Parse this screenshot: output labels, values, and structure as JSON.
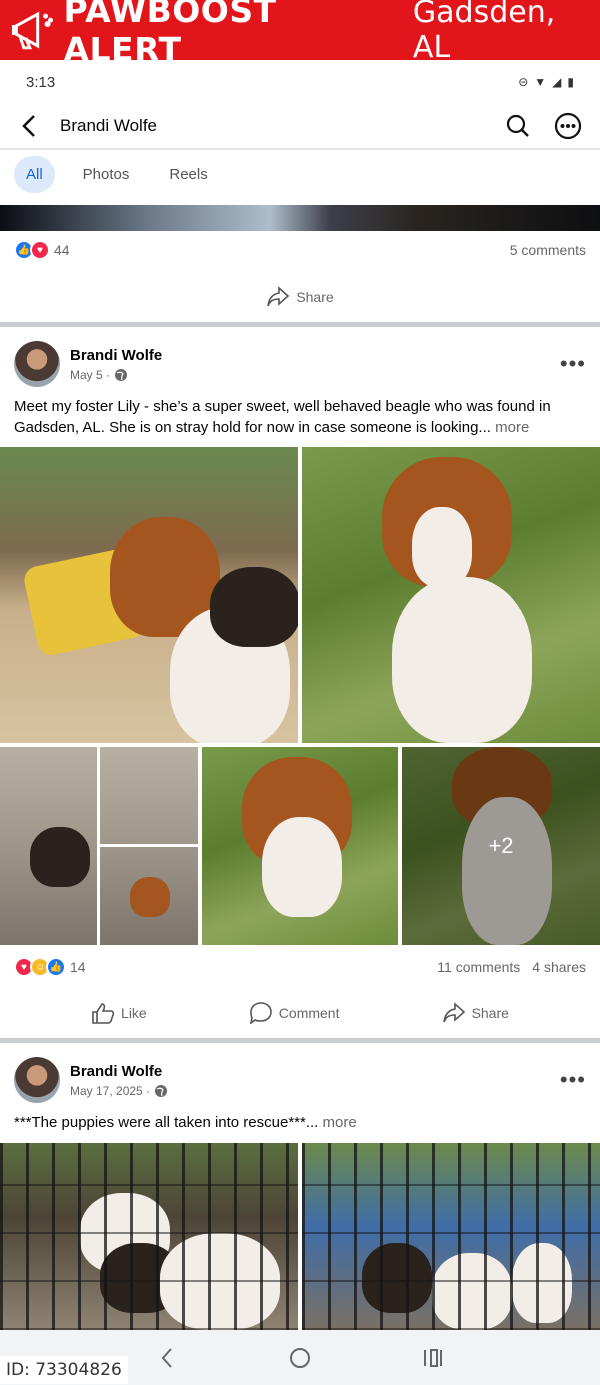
{
  "banner": {
    "brand": "PAWBOOST ALERT",
    "city": "Gadsden, AL",
    "icon": "megaphone-paw-icon",
    "color": "#e2151b"
  },
  "status": {
    "time": "3:13"
  },
  "header": {
    "title": "Brandi Wolfe",
    "back_icon": "back-arrow-icon",
    "search_icon": "search-icon",
    "more_icon": "more-circle-icon"
  },
  "tabs": [
    {
      "label": "All",
      "active": true
    },
    {
      "label": "Photos"
    },
    {
      "label": "Reels"
    }
  ],
  "prev_post": {
    "reaction_count": "44",
    "comments": "5 comments",
    "share_label": "Share"
  },
  "post1": {
    "author": "Brandi Wolfe",
    "date": "May 5 ·",
    "text": "Meet my foster Lily - she’s a super sweet, well behaved beagle who was found in Gadsden, AL. She is on stray hold for now in case someone is looking...",
    "more": " more",
    "extra_photos": "+2",
    "reaction_count": "14",
    "comments": "11 comments",
    "shares": "4 shares",
    "like_label": "Like",
    "comment_label": "Comment",
    "share_label": "Share"
  },
  "post2": {
    "author": "Brandi Wolfe",
    "date": "May 17, 2025 ·",
    "text": "***The puppies were all taken into rescue***...",
    "more": " more"
  },
  "footer": {
    "listing_id": "ID: 73304826"
  }
}
